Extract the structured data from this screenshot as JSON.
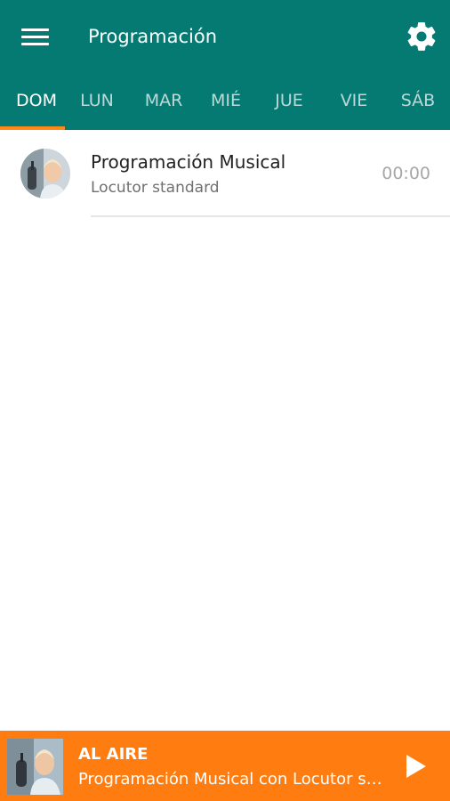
{
  "app_bar": {
    "title": "Programación",
    "menu_icon": "menu-icon",
    "settings_icon": "gear-icon",
    "background_color": "#047a73",
    "accent_color": "#ff8a17"
  },
  "tabs": [
    {
      "label": "DOM",
      "active": true
    },
    {
      "label": "LUN",
      "active": false
    },
    {
      "label": "MAR",
      "active": false
    },
    {
      "label": "MIÉ",
      "active": false
    },
    {
      "label": "JUE",
      "active": false
    },
    {
      "label": "VIE",
      "active": false
    },
    {
      "label": "SÁB",
      "active": false
    }
  ],
  "schedule": [
    {
      "title": "Programación Musical",
      "host": "Locutor standard",
      "time": "00:00"
    }
  ],
  "player": {
    "status": "AL AIRE",
    "description": "Programación Musical con Locutor standard",
    "play_icon": "play-icon",
    "background_color": "#ff7d10"
  }
}
